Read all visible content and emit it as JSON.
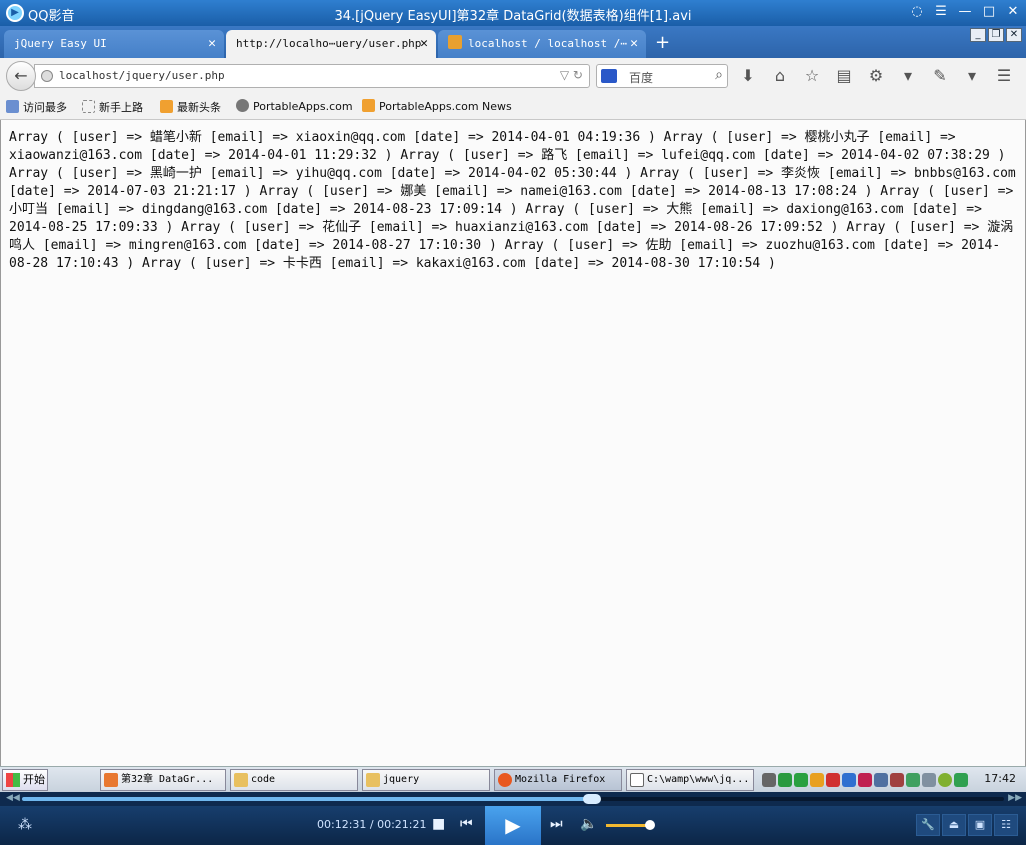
{
  "player": {
    "app_name": "QQ影音",
    "file_title": "34.[jQuery EasyUI]第32章 DataGrid(数据表格)组件[1].avi",
    "time_display": "00:12:31 / 00:21:21",
    "progress_fraction": 0.58,
    "volume_fraction": 0.85
  },
  "browser": {
    "tabs": [
      {
        "label": "jQuery Easy UI",
        "active": false
      },
      {
        "label": "http://localho⋯uery/user.php",
        "active": true
      },
      {
        "label": "localhost / localhost /⋯",
        "active": false
      }
    ],
    "url": "localhost/jquery/user.php",
    "search_placeholder": "百度",
    "bookmarks": [
      {
        "label": "访问最多",
        "icon": "most-visited-icon"
      },
      {
        "label": "新手上路",
        "icon": "page-icon"
      },
      {
        "label": "最新头条",
        "icon": "rss-icon"
      },
      {
        "label": "PortableApps.com",
        "icon": "portableapps-icon"
      },
      {
        "label": "PortableApps.com News",
        "icon": "rss-icon"
      }
    ]
  },
  "page": {
    "output_text": "Array ( [user] => 蜡笔小新 [email] => xiaoxin@qq.com [date] => 2014-04-01 04:19:36 ) Array ( [user] => 樱桃小丸子 [email] => xiaowanzi@163.com [date] => 2014-04-01 11:29:32 ) Array ( [user] => 路飞 [email] => lufei@qq.com [date] => 2014-04-02 07:38:29 ) Array ( [user] => 黑崎一护 [email] => yihu@qq.com [date] => 2014-04-02 05:30:44 ) Array ( [user] => 李炎恢 [email] => bnbbs@163.com [date] => 2014-07-03 21:21:17 ) Array ( [user] => 娜美 [email] => namei@163.com [date] => 2014-08-13 17:08:24 ) Array ( [user] => 小叮当 [email] => dingdang@163.com [date] => 2014-08-23 17:09:14 ) Array ( [user] => 大熊 [email] => daxiong@163.com [date] => 2014-08-25 17:09:33 ) Array ( [user] => 花仙子 [email] => huaxianzi@163.com [date] => 2014-08-26 17:09:52 ) Array ( [user] => 漩涡鸣人 [email] => mingren@163.com [date] => 2014-08-27 17:10:30 ) Array ( [user] => 佐助 [email] => zuozhu@163.com [date] => 2014-08-28 17:10:43 ) Array ( [user] => 卡卡西 [email] => kakaxi@163.com [date] => 2014-08-30 17:10:54 )"
  },
  "taskbar": {
    "start_label": "开始",
    "tasks": [
      {
        "label": "第32章 DataGr...",
        "active": false
      },
      {
        "label": "code",
        "active": false
      },
      {
        "label": "jquery",
        "active": false
      },
      {
        "label": "Mozilla Firefox",
        "active": true
      },
      {
        "label": "C:\\wamp\\www\\jq...",
        "active": false
      }
    ],
    "clock": "17:42"
  }
}
